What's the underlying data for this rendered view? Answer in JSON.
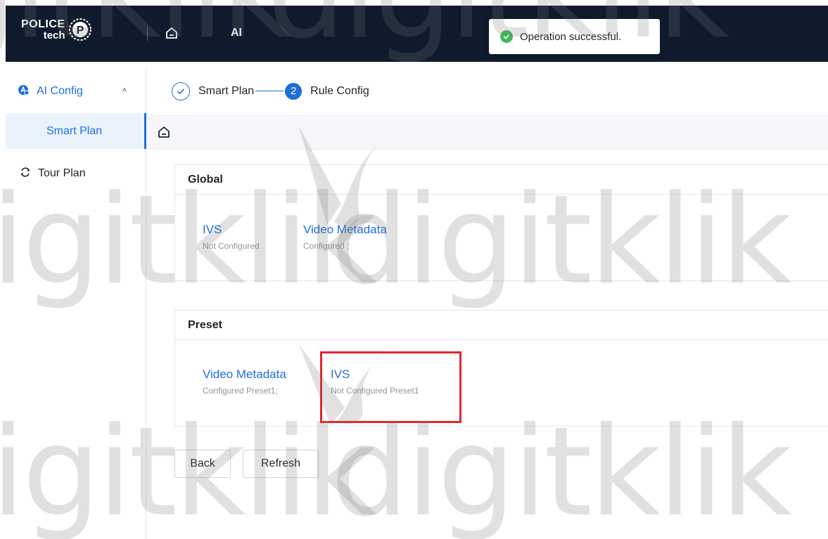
{
  "header": {
    "logo_line1": "POLICE",
    "logo_line2": "tech",
    "logo_badge_letter": "P",
    "title": "AI",
    "toast_text": "Operation successful.",
    "toast_icon": "check-circle-icon",
    "background_color": "#0f1b2d"
  },
  "sidebar": {
    "group_label": "AI Config",
    "group_icon": "ai-config-icon",
    "caret": "^",
    "sub_item_label": "Smart Plan",
    "item_label": "Tour Plan",
    "item_icon": "tour-plan-icon",
    "accent_color": "#1e6fd9"
  },
  "steps": {
    "step1_label": "Smart Plan",
    "step2_number": "2",
    "step2_label": "Rule Config"
  },
  "global_card": {
    "title": "Global",
    "plans": [
      {
        "name": "IVS",
        "status": "Not Configured"
      },
      {
        "name": "Video Metadata",
        "status": "Configured ;"
      }
    ]
  },
  "preset_card": {
    "title": "Preset",
    "plans": [
      {
        "name": "Video Metadata",
        "status": "Configured Preset1;"
      },
      {
        "name": "IVS",
        "status": "Not Configured Preset1"
      }
    ]
  },
  "buttons": {
    "back": "Back",
    "refresh": "Refresh"
  },
  "watermark": {
    "text": "digitklik"
  }
}
